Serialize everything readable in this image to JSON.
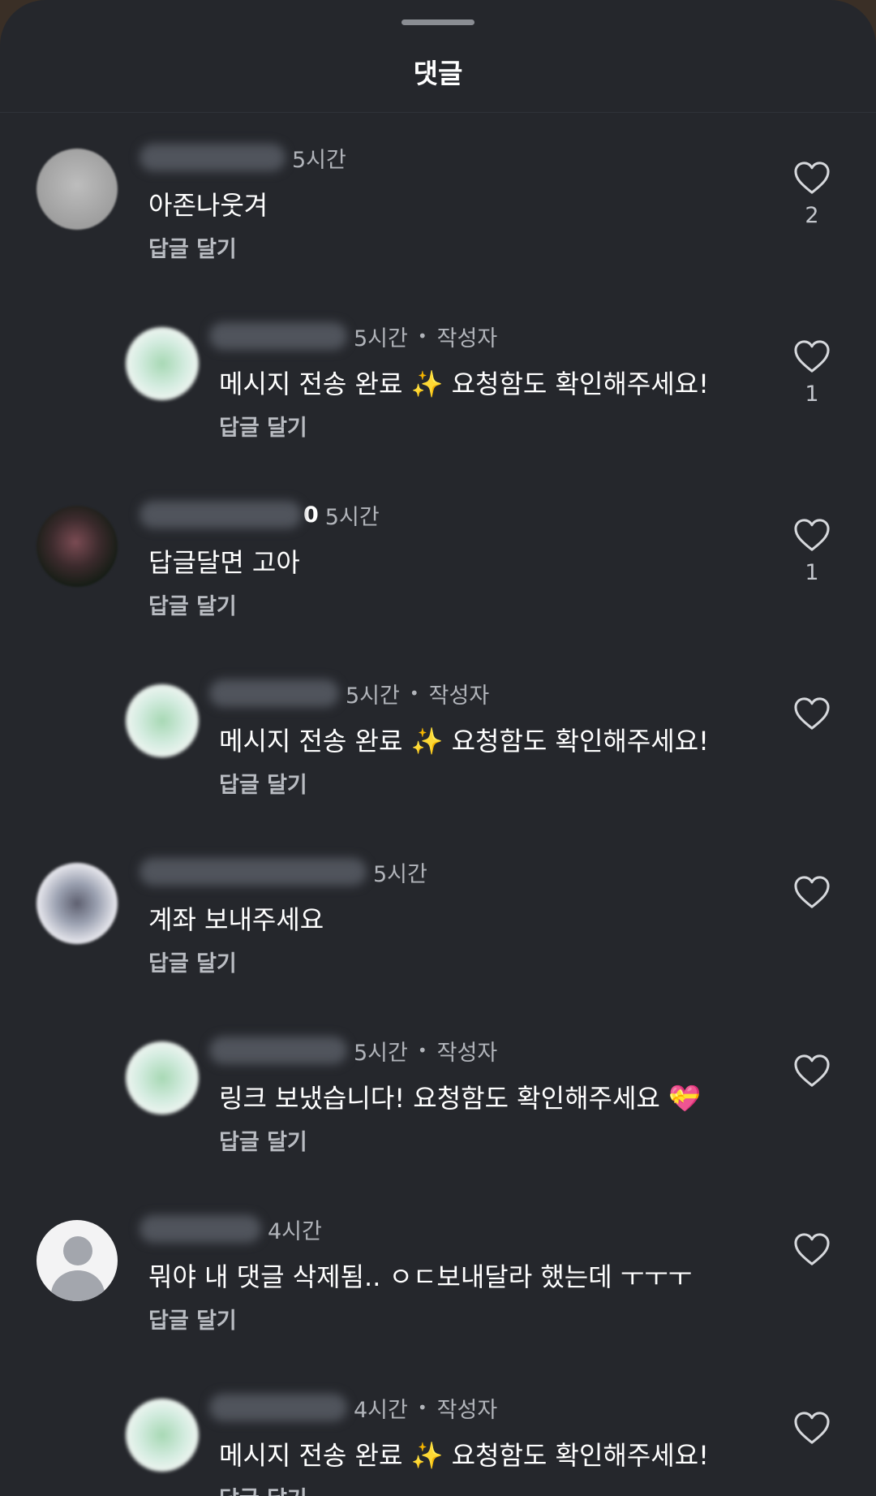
{
  "header": {
    "title": "댓글"
  },
  "comments": [
    {
      "kind": "top",
      "avatar": "gray",
      "username_hidden": true,
      "suffix": "",
      "time": "5시간",
      "author_tag": "",
      "text": "아존나웃겨",
      "reply_label": "답글 달기",
      "likes": "2"
    },
    {
      "kind": "reply",
      "avatar": "green",
      "username_hidden": true,
      "suffix": "",
      "time": "5시간",
      "author_tag": "작성자",
      "text": "메시지 전송 완료 ✨ 요청함도 확인해주세요!",
      "reply_label": "답글 달기",
      "likes": "1"
    },
    {
      "kind": "top",
      "avatar": "dark",
      "username_hidden": true,
      "suffix": "0",
      "time": "5시간",
      "author_tag": "",
      "text": "답글달면 고아",
      "reply_label": "답글 달기",
      "likes": "1"
    },
    {
      "kind": "reply",
      "avatar": "green",
      "username_hidden": true,
      "suffix": "",
      "time": "5시간",
      "author_tag": "작성자",
      "text": "메시지 전송 완료 ✨ 요청함도 확인해주세요!",
      "reply_label": "답글 달기",
      "likes": ""
    },
    {
      "kind": "top",
      "avatar": "mixed",
      "username_hidden": true,
      "suffix": "",
      "time": "5시간",
      "author_tag": "",
      "text": "계좌 보내주세요",
      "reply_label": "답글 달기",
      "likes": ""
    },
    {
      "kind": "reply",
      "avatar": "green",
      "username_hidden": true,
      "suffix": "",
      "time": "5시간",
      "author_tag": "작성자",
      "text": "링크 보냈습니다! 요청함도 확인해주세요 💝",
      "reply_label": "답글 달기",
      "likes": ""
    },
    {
      "kind": "top",
      "avatar": "default",
      "username_hidden": true,
      "suffix": "",
      "time": "4시간",
      "author_tag": "",
      "text": "뭐야 내 댓글 삭제됨.. ㅇㄷ보내달라 했는데 ㅜㅜㅜ",
      "reply_label": "답글 달기",
      "likes": ""
    },
    {
      "kind": "reply",
      "avatar": "green",
      "username_hidden": true,
      "suffix": "",
      "time": "4시간",
      "author_tag": "작성자",
      "text": "메시지 전송 완료 ✨ 요청함도 확인해주세요!",
      "reply_label": "답글 달기",
      "likes": ""
    }
  ],
  "icons": {
    "like": "heart-outline-icon"
  },
  "colors": {
    "background": "#25272c",
    "text": "#ffffff",
    "muted": "#b1b4ba"
  }
}
